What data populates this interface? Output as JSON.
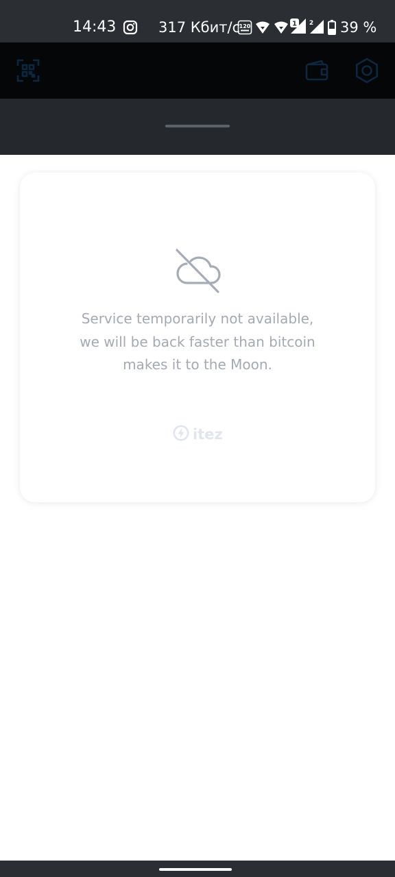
{
  "status_bar": {
    "time": "14:43",
    "network_speed": "317 Кбит/с",
    "refresh_rate_badge": "120",
    "sim1_badge": "1",
    "sim2_badge": "2",
    "battery": "39 %",
    "icons": [
      "instagram-icon",
      "120hz-icon",
      "wifi-icon",
      "wifi-icon",
      "signal-icon",
      "signal-icon",
      "battery-icon"
    ]
  },
  "header": {
    "icons": [
      "qr-scan-icon",
      "wallet-icon",
      "settings-icon"
    ],
    "accent_color": "#0b2238"
  },
  "card": {
    "icon": "cloud-off-icon",
    "message_lines": [
      "Service temporarily not available,",
      "we will be back faster than bitcoin",
      "makes it to the Moon."
    ],
    "brand_icon": "lightning-circle-icon",
    "brand_name": "itez",
    "text_color": "#a4a9b2"
  }
}
